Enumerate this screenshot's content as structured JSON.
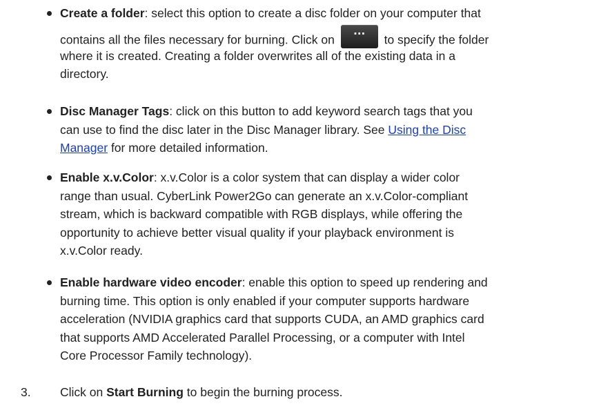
{
  "bullets": [
    {
      "term": "Create a folder",
      "line1": ": select this option to create a disc folder on your computer that",
      "line2_before": "contains all the files necessary for burning. Click on",
      "button_symbol": "···",
      "line2_after": "to specify the folder",
      "line3": "where it is created. Creating a folder overwrites all of the existing data in a",
      "line4": "directory."
    },
    {
      "term": "Disc Manager Tags",
      "line1": ": click on this button to add keyword search tags that you",
      "line2": "can use to find the disc later in the Disc Manager library. See",
      "link_part1": "Using the Disc",
      "link_part2": "Manager",
      "line3_after": " for more detailed information."
    },
    {
      "term": "Enable x.v.Color",
      "line1": ": x.v.Color is a color system that can display a wider color",
      "line2": "range than usual. CyberLink Power2Go can generate an x.v.Color-compliant",
      "line3": "stream, which is backward compatible with RGB displays, while offering the",
      "line4": "opportunity to achieve better visual quality if your playback environment is",
      "line5": "x.v.Color ready."
    },
    {
      "term": "Enable hardware video encoder",
      "line1": ": enable this option to speed up rendering and",
      "line2": "burning time. This option is only enabled if your computer supports hardware",
      "line3": "acceleration (NVIDIA graphics card that supports CUDA, an AMD graphics card",
      "line4": "that supports AMD Accelerated Parallel Processing, or a computer with Intel",
      "line5": "Core Processor Family technology)."
    }
  ],
  "step": {
    "number": "3.",
    "before": "Click on ",
    "bold": "Start Burning",
    "after": " to begin the burning process."
  }
}
